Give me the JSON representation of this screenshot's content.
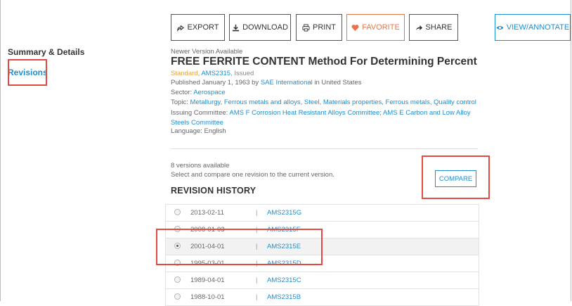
{
  "toolbar": {
    "export": "EXPORT",
    "download": "DOWNLOAD",
    "print": "PRINT",
    "favorite": "FAVORITE",
    "share": "SHARE",
    "view_annotate": "VIEW/ANNOTATE"
  },
  "sidebar": {
    "summary": "Summary & Details",
    "revisions": "Revisions"
  },
  "document": {
    "notice": "Newer Version Available",
    "title": "FREE FERRITE CONTENT Method For Determining Percent",
    "type": "Standard",
    "code": "AMS2315",
    "status": "Issued",
    "published_prefix": "Published January 1, 1963 by ",
    "publisher": "SAE International",
    "published_suffix": " in United States",
    "sector_label": "Sector: ",
    "sector": "Aerospace",
    "topic_label": "Topic: ",
    "topics": "Metallurgy, Ferrous metals and alloys, Steel, Materials properties, Ferrous metals, Quality control",
    "committee_label": "Issuing Committee: ",
    "committees": "AMS F Corrosion Heat Resistant Alloys Committee; AMS E Carbon and Low Alloy Steels Committee",
    "language": "Language: English"
  },
  "revisions": {
    "count_text": "8 versions available",
    "hint": "Select and compare one revision to the current version.",
    "heading": "REVISION HISTORY",
    "compare_label": "COMPARE",
    "rows": [
      {
        "date": "2013-02-11",
        "code": "AMS2315G",
        "selected": false
      },
      {
        "date": "2008-01-03",
        "code": "AMS2315F",
        "selected": false
      },
      {
        "date": "2001-04-01",
        "code": "AMS2315E",
        "selected": true
      },
      {
        "date": "1995-03-01",
        "code": "AMS2315D",
        "selected": false
      },
      {
        "date": "1989-04-01",
        "code": "AMS2315C",
        "selected": false
      },
      {
        "date": "1988-10-01",
        "code": "AMS2315B",
        "selected": false
      }
    ]
  },
  "colors": {
    "link": "#1b8fd1",
    "favorite": "#e8754a",
    "highlight": "#e14a43",
    "standard": "#e7a23a"
  }
}
